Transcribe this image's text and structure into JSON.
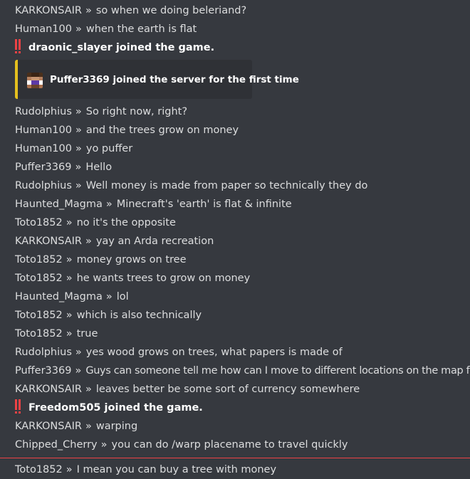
{
  "chat": {
    "messages": [
      {
        "author": "KARKONSAIR",
        "text": "so when we doing beleriand?"
      },
      {
        "author": "Human100",
        "text": "when the earth is flat"
      },
      {
        "join": "draonic_slayer joined the game."
      },
      {
        "embed": "Puffer3369 joined the server for the first time"
      },
      {
        "author": "Rudolphius",
        "text": "So right now, right?"
      },
      {
        "author": "Human100",
        "text": "and the trees grow on money"
      },
      {
        "author": "Human100",
        "text": "yo puffer"
      },
      {
        "author": "Puffer3369",
        "text": "Hello"
      },
      {
        "author": "Rudolphius",
        "text": "Well money is made from paper so technically they do"
      },
      {
        "author": "Haunted_Magma",
        "text": "Minecraft's 'earth' is flat & infinite"
      },
      {
        "author": "Toto1852",
        "text": "no it's the opposite"
      },
      {
        "author": "KARKONSAIR",
        "text": "yay an Arda recreation"
      },
      {
        "author": "Toto1852",
        "text": "money grows on tree"
      },
      {
        "author": "Toto1852",
        "text": "he wants trees to grow on money"
      },
      {
        "author": "Haunted_Magma",
        "text": "lol"
      },
      {
        "author": "Toto1852",
        "text": "which is also technically"
      },
      {
        "author": "Toto1852",
        "text": "true"
      },
      {
        "author": "Rudolphius",
        "text": "yes wood grows on trees, what papers is made of"
      },
      {
        "author": "Puffer3369",
        "text": "Guys can someone tell me how can I move to different locations on the map fast?"
      },
      {
        "author": "KARKONSAIR",
        "text": "leaves better be some sort of currency somewhere"
      },
      {
        "join": "Freedom505 joined the game."
      },
      {
        "author": "KARKONSAIR",
        "text": "warping"
      },
      {
        "author": "Chipped_Cherry",
        "text": "you can do /warp placename to travel quickly"
      },
      {
        "author": "Toto1852",
        "text": "I mean you can buy a tree with money"
      }
    ],
    "separator": "»"
  },
  "colors": {
    "background": "#36393f",
    "text": "#dcddde",
    "join_icon": "#ed4245",
    "embed_accent": "#e5c01e",
    "embed_bg": "#2f3136",
    "new_messages_line": "#ed4245"
  },
  "icons": {
    "join": "double-exclamation-icon",
    "embed_avatar": "minecraft-player-head-icon"
  }
}
